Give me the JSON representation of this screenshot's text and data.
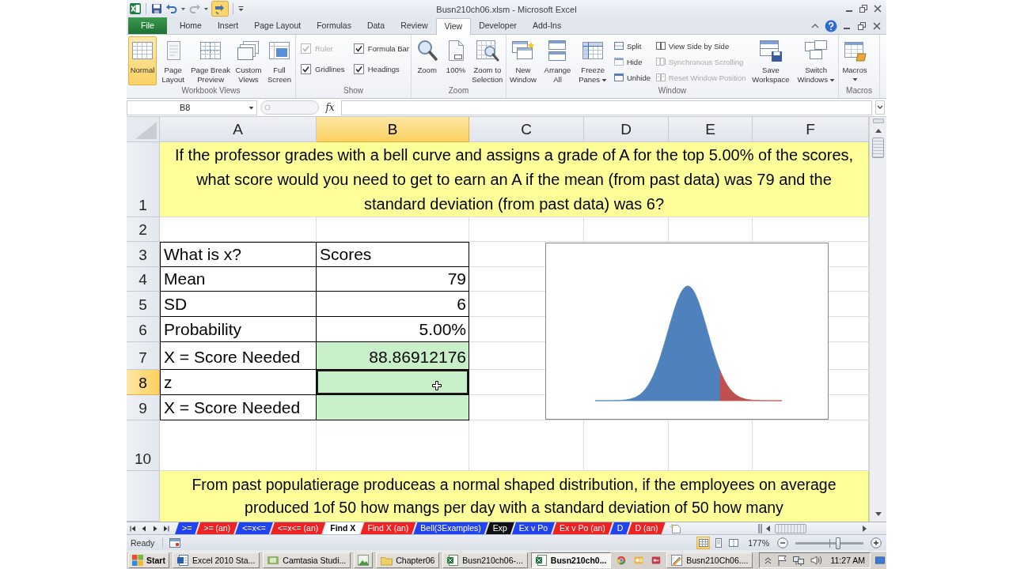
{
  "window": {
    "title": "Busn210ch06.xlsm - Microsoft Excel"
  },
  "ribbon_tabs": [
    {
      "label": "File",
      "kind": "file",
      "selected": false
    },
    {
      "label": "Home",
      "kind": "tab",
      "selected": false
    },
    {
      "label": "Insert",
      "kind": "tab",
      "selected": false
    },
    {
      "label": "Page Layout",
      "kind": "tab",
      "selected": false
    },
    {
      "label": "Formulas",
      "kind": "tab",
      "selected": false
    },
    {
      "label": "Data",
      "kind": "tab",
      "selected": false
    },
    {
      "label": "Review",
      "kind": "tab",
      "selected": false
    },
    {
      "label": "View",
      "kind": "tab",
      "selected": true
    },
    {
      "label": "Developer",
      "kind": "tab",
      "selected": false
    },
    {
      "label": "Add-Ins",
      "kind": "tab",
      "selected": false
    }
  ],
  "ribbon_groups": [
    {
      "label": "Workbook Views",
      "items": [
        {
          "kind": "large",
          "lines": [
            "Normal"
          ],
          "selected": true,
          "has_menu": false
        },
        {
          "kind": "large",
          "lines": [
            "Page",
            "Layout"
          ],
          "selected": false,
          "has_menu": false
        },
        {
          "kind": "large",
          "lines": [
            "Page Break",
            "Preview"
          ],
          "selected": false,
          "has_menu": false
        },
        {
          "kind": "large",
          "lines": [
            "Custom",
            "Views"
          ],
          "selected": false,
          "has_menu": false
        },
        {
          "kind": "large",
          "lines": [
            "Full",
            "Screen"
          ],
          "selected": false,
          "has_menu": false
        }
      ]
    },
    {
      "label": "Show",
      "items": [
        {
          "kind": "stack",
          "items": [
            {
              "kind": "check",
              "label": "Ruler",
              "checked": true,
              "disabled": true
            },
            {
              "kind": "check",
              "label": "Gridlines",
              "checked": true,
              "disabled": false
            }
          ]
        },
        {
          "kind": "stack",
          "items": [
            {
              "kind": "check",
              "label": "Formula Bar",
              "checked": true,
              "disabled": false
            },
            {
              "kind": "check",
              "label": "Headings",
              "checked": true,
              "disabled": false
            }
          ]
        }
      ]
    },
    {
      "label": "Zoom",
      "items": [
        {
          "kind": "large",
          "lines": [
            "Zoom"
          ],
          "selected": false,
          "has_menu": false
        },
        {
          "kind": "large",
          "lines": [
            "100%"
          ],
          "selected": false,
          "has_menu": false
        },
        {
          "kind": "large",
          "lines": [
            "Zoom to",
            "Selection"
          ],
          "selected": false,
          "has_menu": false
        }
      ]
    },
    {
      "label": "Window",
      "items": [
        {
          "kind": "large",
          "lines": [
            "New",
            "Window"
          ],
          "selected": false,
          "has_menu": false
        },
        {
          "kind": "large",
          "lines": [
            "Arrange",
            "All"
          ],
          "selected": false,
          "has_menu": false
        },
        {
          "kind": "large",
          "lines": [
            "Freeze",
            "Panes"
          ],
          "selected": false,
          "has_menu": true
        },
        {
          "kind": "stack",
          "items": [
            {
              "kind": "small",
              "label": "Split",
              "disabled": false
            },
            {
              "kind": "small",
              "label": "Hide",
              "disabled": false
            },
            {
              "kind": "small",
              "label": "Unhide",
              "disabled": false
            }
          ]
        },
        {
          "kind": "stack",
          "items": [
            {
              "kind": "small",
              "label": "View Side by Side",
              "disabled": false
            },
            {
              "kind": "small",
              "label": "Synchronous Scrolling",
              "disabled": true
            },
            {
              "kind": "small",
              "label": "Reset Window Position",
              "disabled": true
            }
          ]
        },
        {
          "kind": "large",
          "lines": [
            "Save",
            "Workspace"
          ],
          "selected": false,
          "has_menu": false
        },
        {
          "kind": "large",
          "lines": [
            "Switch",
            "Windows"
          ],
          "selected": false,
          "has_menu": true
        }
      ]
    },
    {
      "label": "Macros",
      "items": [
        {
          "kind": "large",
          "lines": [
            "Macros"
          ],
          "selected": false,
          "has_menu": true
        }
      ]
    }
  ],
  "formula_bar": {
    "name_box": "B8",
    "function_label": "fx"
  },
  "columns": [
    {
      "label": "A",
      "selected": false
    },
    {
      "label": "B",
      "selected": true
    },
    {
      "label": "C",
      "selected": false
    },
    {
      "label": "D",
      "selected": false
    },
    {
      "label": "E",
      "selected": false
    },
    {
      "label": "F",
      "selected": false
    }
  ],
  "rows": [
    {
      "header": "1",
      "selected": false,
      "kind": "banner",
      "text": "If the professor grades with a bell curve and assigns a grade of A for the top 5.00% of the scores, what score would you need to get to earn an A if the mean (from past data) was 79 and the standard deviation (from past data) was 6?"
    },
    {
      "header": "2",
      "selected": false,
      "kind": "blank"
    },
    {
      "header": "3",
      "selected": false,
      "kind": "table",
      "cells": [
        {
          "text": "What is x?",
          "kind": "text",
          "highlighted": false,
          "selected": false
        },
        {
          "text": "Scores",
          "kind": "text",
          "highlighted": false,
          "selected": false
        }
      ]
    },
    {
      "header": "4",
      "selected": false,
      "kind": "table",
      "cells": [
        {
          "text": "Mean",
          "kind": "text",
          "highlighted": false,
          "selected": false
        },
        {
          "text": "79",
          "kind": "number",
          "highlighted": false,
          "selected": false
        }
      ]
    },
    {
      "header": "5",
      "selected": false,
      "kind": "table",
      "cells": [
        {
          "text": "SD",
          "kind": "text",
          "highlighted": false,
          "selected": false
        },
        {
          "text": "6",
          "kind": "number",
          "highlighted": false,
          "selected": false
        }
      ]
    },
    {
      "header": "6",
      "selected": false,
      "kind": "table",
      "cells": [
        {
          "text": "Probability",
          "kind": "text",
          "highlighted": false,
          "selected": false
        },
        {
          "text": "5.00%",
          "kind": "number",
          "highlighted": false,
          "selected": false
        }
      ]
    },
    {
      "header": "7",
      "selected": false,
      "kind": "table",
      "cells": [
        {
          "text": "X = Score Needed",
          "kind": "text",
          "highlighted": false,
          "selected": false
        },
        {
          "text": "88.86912176",
          "kind": "number",
          "highlighted": true,
          "selected": false
        }
      ]
    },
    {
      "header": "8",
      "selected": true,
      "kind": "table",
      "cells": [
        {
          "text": "z",
          "kind": "text",
          "highlighted": false,
          "selected": false
        },
        {
          "highlighted": true,
          "selected": true
        }
      ]
    },
    {
      "header": "9",
      "selected": false,
      "kind": "table",
      "cells": [
        {
          "text": "X = Score Needed",
          "kind": "text",
          "highlighted": false,
          "selected": false
        },
        {
          "highlighted": true,
          "selected": false
        }
      ]
    },
    {
      "header": "10",
      "selected": false,
      "kind": "blank"
    },
    {
      "selected": false,
      "kind": "banner",
      "text": "From past populatierage produceas a normal shaped distribution, if the employees on average produced 1of 50 how mangs per day with a standard deviation of 50 how many"
    }
  ],
  "sheet_tabs": [
    {
      "label": ">=",
      "color": "#2244ee",
      "selected": false
    },
    {
      "label": ">= (an)",
      "color": "#ee2222",
      "selected": false
    },
    {
      "label": "<=x<=",
      "color": "#2244ee",
      "selected": false
    },
    {
      "label": "<=x<= (an)",
      "color": "#ee2222",
      "selected": false
    },
    {
      "label": "Find X",
      "selected": true
    },
    {
      "label": "Find X (an)",
      "color": "#ee2222",
      "selected": false
    },
    {
      "label": "Bell(3Examples)",
      "color": "#2244ee",
      "selected": false
    },
    {
      "label": "Exp",
      "color": "#111111",
      "selected": false
    },
    {
      "label": "Ex v Po",
      "color": "#2244ee",
      "selected": false
    },
    {
      "label": "Ex v Po (an)",
      "color": "#ee2222",
      "selected": false
    },
    {
      "label": "D",
      "color": "#2244ee",
      "selected": false
    },
    {
      "label": "D (an)",
      "color": "#ee2222",
      "selected": false
    }
  ],
  "status_bar": {
    "mode": "Ready",
    "view_buttons": [
      {
        "selected": true
      },
      {
        "selected": false
      },
      {
        "selected": false
      }
    ],
    "zoom": {
      "reading": "177%",
      "level": 0.62
    }
  },
  "taskbar": {
    "start_label": "Start",
    "items": [
      {
        "kind": "window",
        "label": "Excel 2010 Sta...",
        "selected": false
      },
      {
        "kind": "window",
        "label": "Camtasia Studi...",
        "selected": false
      },
      {
        "kind": "window_icon",
        "selected": false
      },
      {
        "kind": "window",
        "label": "Chapter06",
        "selected": false
      },
      {
        "kind": "window",
        "label": "Busn210ch06-...",
        "selected": false
      },
      {
        "kind": "window",
        "label": "Busn210ch0...",
        "selected": true
      },
      {
        "kind": "launcher"
      },
      {
        "kind": "launcher"
      },
      {
        "kind": "launcher"
      },
      {
        "kind": "window",
        "label": "Busn210Ch06....",
        "selected": false
      }
    ],
    "clock": "11:27 AM"
  }
}
